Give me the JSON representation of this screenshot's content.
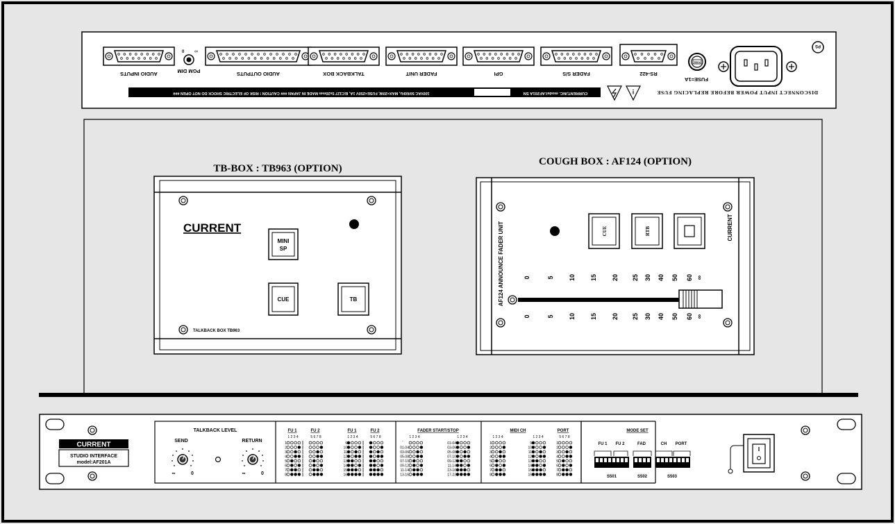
{
  "rear_panel": {
    "connectors": [
      "AUDIO INPUTS",
      "AUDIO OUTPUTS",
      "TALKBACK BOX",
      "FADER UNIT",
      "GPI",
      "FADER S/S",
      "RS-422"
    ],
    "pgm_dim": "PGM DIM",
    "fuse": "FUSE=1A",
    "fuse_cap": "FUSE",
    "warning": "DISCONNECT INPUT POWER BEFORE REPLACING FUSE",
    "label_left": "CURRENT,INC. model:AF201A SN",
    "label_right": "100VAC 50/60Hz, MAX=20W, FUSE=250V 1A, IEC127 5x20mm MADE IN JAPAN  ### CAUTION ! RISK OF ELECTRIC SHOCK DO NOT OPEN ###"
  },
  "tb_box": {
    "title": "TB-BOX : TB963 (OPTION)",
    "brand": "CURRENT",
    "buttons": [
      "MINI",
      "SP",
      "CUE",
      "TB"
    ],
    "model": "TALKBACK BOX TB963"
  },
  "cough_box": {
    "title": "COUGH BOX : AF124 (OPTION)",
    "side_label": "AF124 ANNOUNCE FADER UNIT",
    "brand": "CURRENT",
    "buttons": [
      "CUE",
      "RTB"
    ],
    "scale": [
      "0",
      "5",
      "10",
      "15",
      "20",
      "25",
      "30",
      "40",
      "50",
      "60",
      "∞"
    ]
  },
  "front_panel": {
    "brand": "CURRENT",
    "name": "STUDIO INTERFACE",
    "model": "model:AF201A",
    "talkback": {
      "title": "TALKBACK LEVEL",
      "send": "SEND",
      "return": "RETURN",
      "inf": "∞",
      "zero": "0"
    },
    "fu_section": {
      "headers": [
        "FU 1",
        "FU 2",
        "FU 1",
        "FU 2"
      ],
      "bits_a": "1 2 3 4",
      "bits_b": "5 6 7 8"
    },
    "fader_section": {
      "header": "FADER START/STOP",
      "bits": "1 2 3 4",
      "dash": "-",
      "rows_left": [
        "01-04",
        "03-06",
        "05-08",
        "07-10",
        "09-12",
        "11-14",
        "13-16"
      ],
      "rows_right": [
        "01-04",
        "03-06",
        "05-08",
        "07-10",
        "09-12",
        "11-14",
        "13-16",
        "17-23"
      ]
    },
    "midi_section": {
      "headers": [
        "MIDI CH",
        "PORT"
      ],
      "bits_a": "1 2 3 4",
      "bits_b": "5 6 7 8"
    },
    "mode_set": {
      "title": "MODE SET",
      "labels": [
        "FU 1",
        "FU 2",
        "FAD",
        "CH",
        "PORT"
      ],
      "switches": [
        "S501",
        "S502",
        "S503"
      ]
    }
  }
}
